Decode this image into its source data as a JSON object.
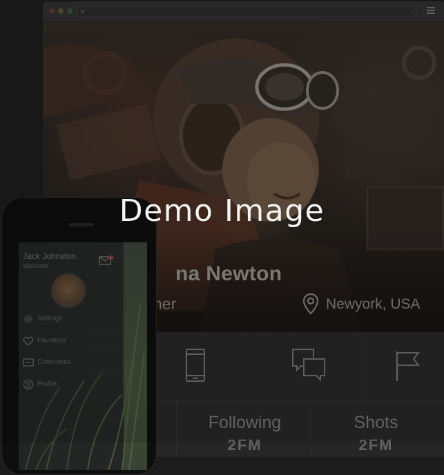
{
  "watermark": "Demo Image",
  "browser": {
    "traffic_lights": [
      "#5a3432",
      "#59502f",
      "#355037"
    ],
    "menu_icon": "hamburger-menu-icon"
  },
  "profile": {
    "name": "na Newton",
    "role": "ner",
    "location": "Newyork, USA",
    "location_icon": "map-pin-icon"
  },
  "stats": {
    "icons": [
      "smartphone-icon",
      "chat-bubbles-icon",
      "flag-icon"
    ],
    "items": [
      {
        "label": "Following",
        "value": "2FM"
      },
      {
        "label": "Shots",
        "value": "2FM"
      }
    ]
  },
  "phone": {
    "user_name": "Jack Johnston",
    "welcome": "Welcome",
    "menu": [
      {
        "label": "Settings",
        "icon": "gear-icon"
      },
      {
        "label": "Favorites",
        "icon": "heart-icon"
      },
      {
        "label": "Comments",
        "icon": "comment-icon"
      },
      {
        "label": "Profile",
        "icon": "user-icon"
      }
    ]
  }
}
